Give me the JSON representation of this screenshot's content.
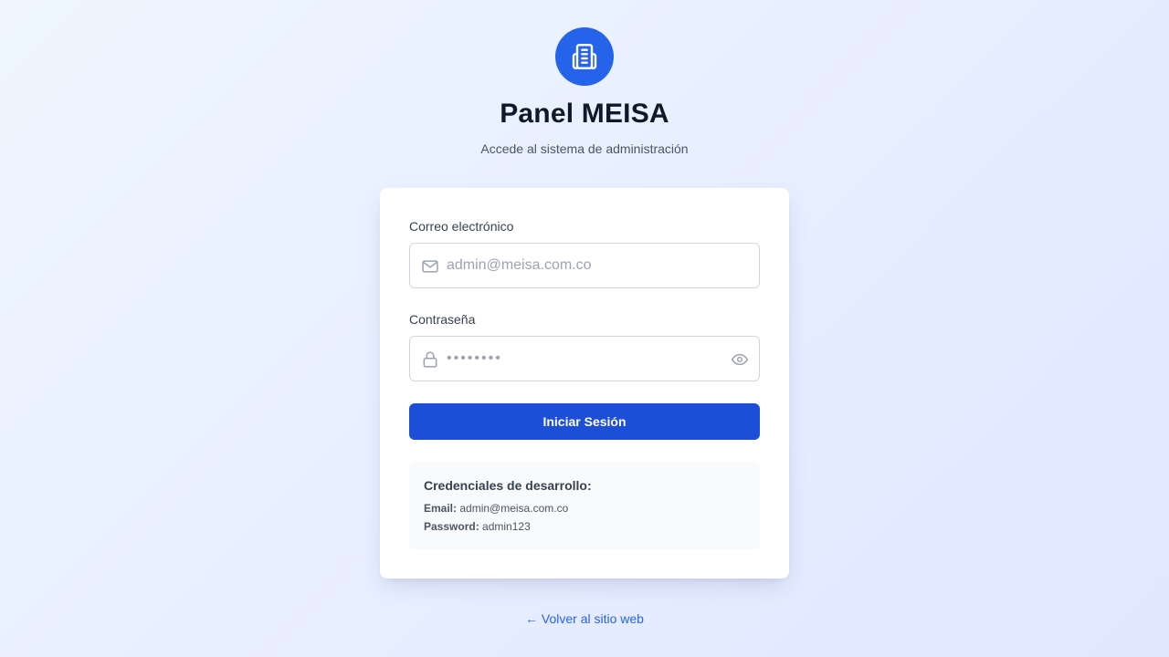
{
  "header": {
    "logo_icon": "building-icon",
    "title": "Panel MEISA",
    "subtitle": "Accede al sistema de administración"
  },
  "form": {
    "email_label": "Correo electrónico",
    "email_placeholder": "admin@meisa.com.co",
    "email_icon": "mail-icon",
    "password_label": "Contraseña",
    "password_placeholder": "••••••••",
    "password_icon": "lock-icon",
    "password_toggle_icon": "eye-icon",
    "submit_label": "Iniciar Sesión"
  },
  "dev_credentials": {
    "title": "Credenciales de desarrollo:",
    "email_key": "Email:",
    "email_value": "admin@meisa.com.co",
    "password_key": "Password:",
    "password_value": "admin123"
  },
  "footer": {
    "back_arrow": "←",
    "back_label": "Volver al sitio web"
  },
  "colors": {
    "primary": "#2563eb",
    "button": "#1d4ed8",
    "background_start": "#eff6ff",
    "background_end": "#e0e7ff"
  }
}
